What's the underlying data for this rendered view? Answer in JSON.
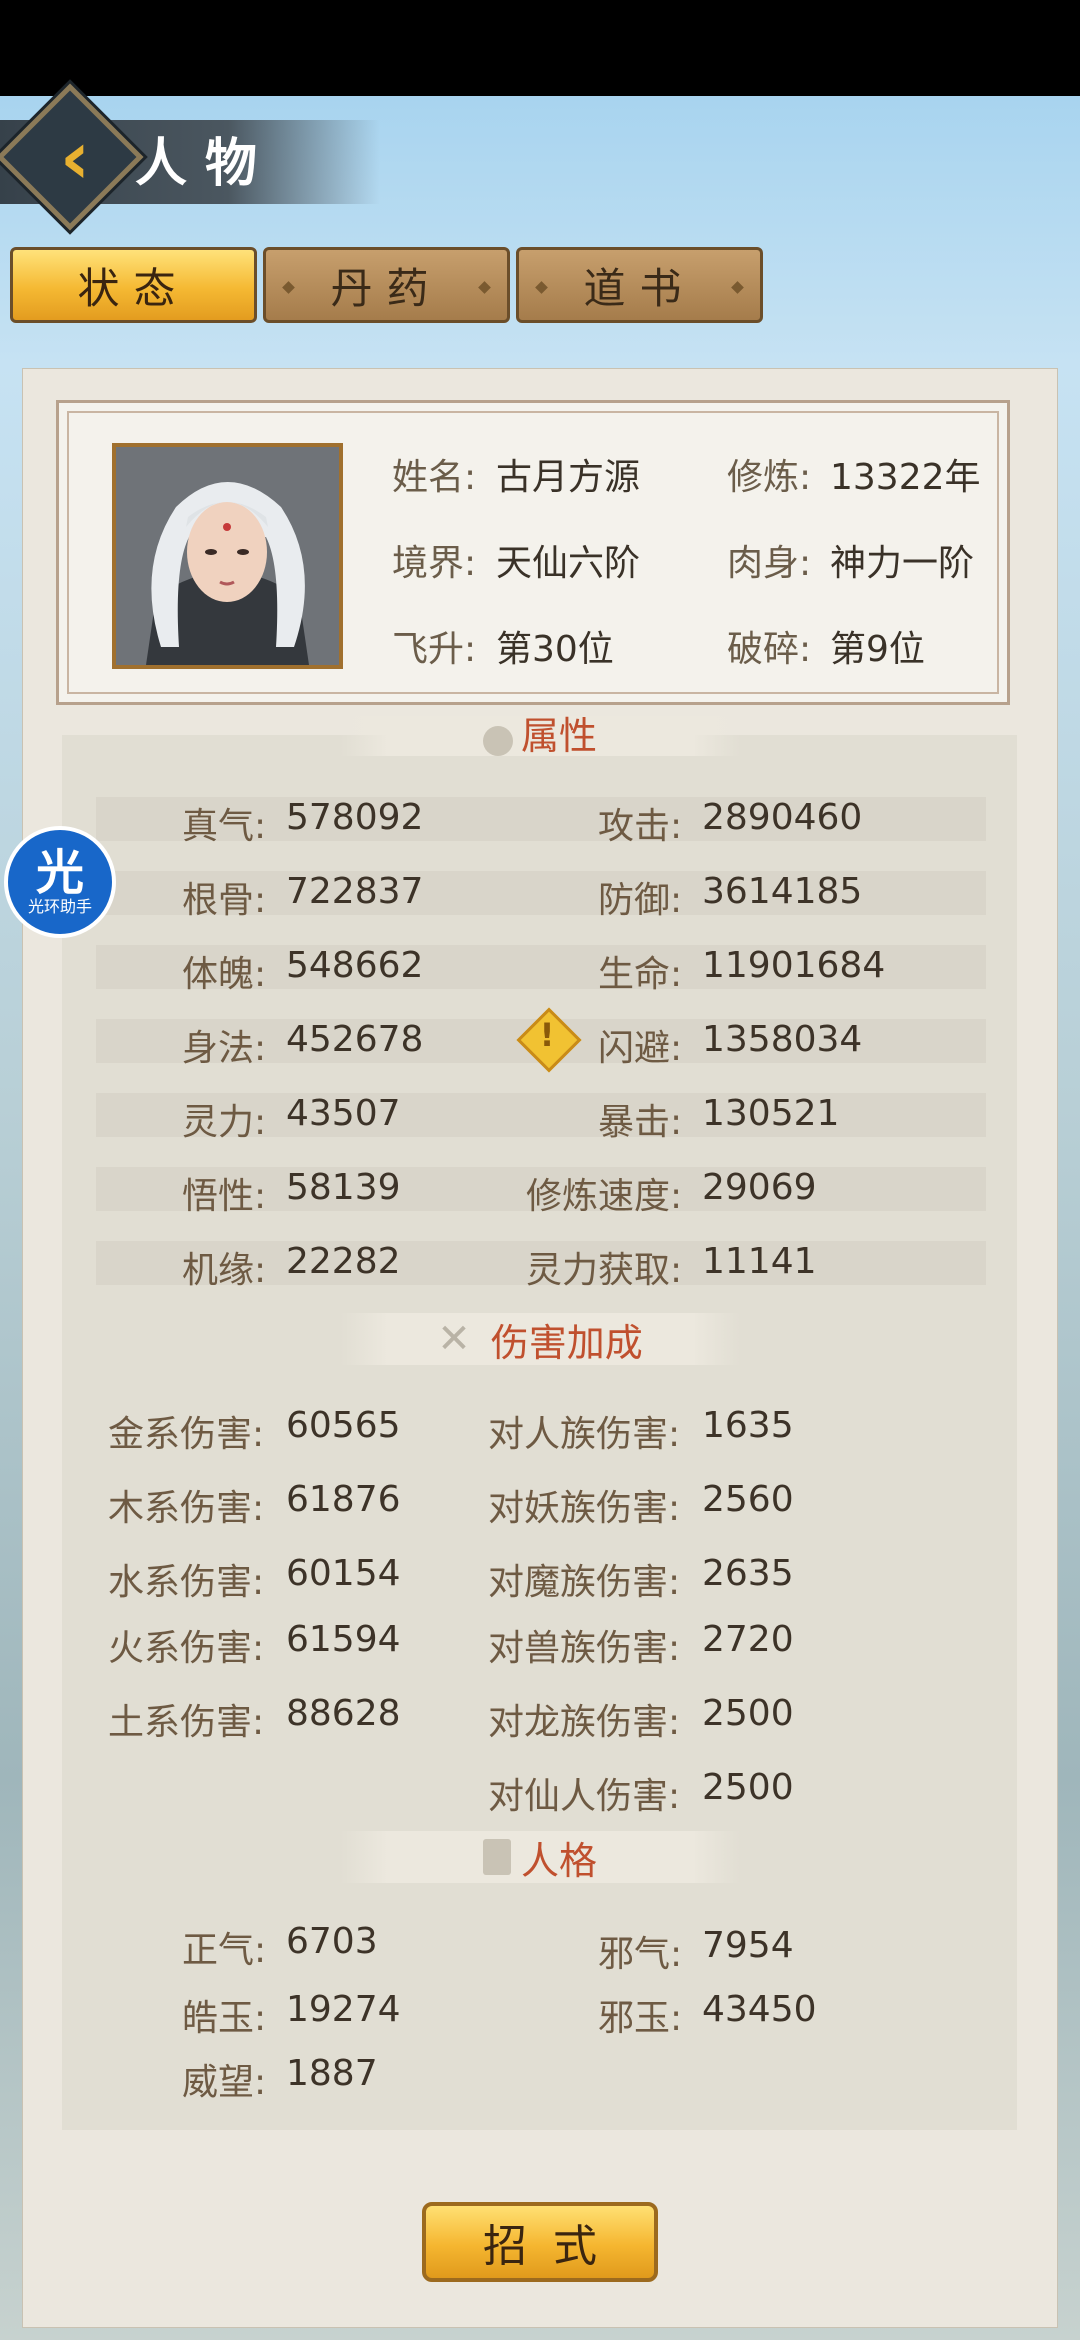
{
  "header": {
    "title": "人物"
  },
  "tabs": [
    {
      "label": "状态",
      "active": true
    },
    {
      "label": "丹药",
      "active": false
    },
    {
      "label": "道书",
      "active": false
    }
  ],
  "profile": {
    "name_label": "姓名:",
    "name": "古月方源",
    "cultivation_label": "修炼:",
    "cultivation": "13322年",
    "realm_label": "境界:",
    "realm": "天仙六阶",
    "body_label": "肉身:",
    "body": "神力一阶",
    "ascend_label": "飞升:",
    "ascend": "第30位",
    "shatter_label": "破碎:",
    "shatter": "第9位"
  },
  "sections": {
    "attributes": "属性",
    "damage": "伤害加成",
    "personality": "人格"
  },
  "attributes": [
    {
      "label": "真气:",
      "value": "578092"
    },
    {
      "label": "攻击:",
      "value": "2890460"
    },
    {
      "label": "根骨:",
      "value": "722837"
    },
    {
      "label": "防御:",
      "value": "3614185"
    },
    {
      "label": "体魄:",
      "value": "548662"
    },
    {
      "label": "生命:",
      "value": "11901684"
    },
    {
      "label": "身法:",
      "value": "452678"
    },
    {
      "label": "闪避:",
      "value": "1358034"
    },
    {
      "label": "灵力:",
      "value": "43507"
    },
    {
      "label": "暴击:",
      "value": "130521"
    },
    {
      "label": "悟性:",
      "value": "58139"
    },
    {
      "label": "修炼速度:",
      "value": "29069"
    },
    {
      "label": "机缘:",
      "value": "22282"
    },
    {
      "label": "灵力获取:",
      "value": "11141"
    }
  ],
  "damage_bonus": [
    {
      "label": "金系伤害:",
      "value": "60565"
    },
    {
      "label": "对人族伤害:",
      "value": "1635"
    },
    {
      "label": "木系伤害:",
      "value": "61876"
    },
    {
      "label": "对妖族伤害:",
      "value": "2560"
    },
    {
      "label": "水系伤害:",
      "value": "60154"
    },
    {
      "label": "对魔族伤害:",
      "value": "2635"
    },
    {
      "label": "火系伤害:",
      "value": "61594"
    },
    {
      "label": "对兽族伤害:",
      "value": "2720"
    },
    {
      "label": "土系伤害:",
      "value": "88628"
    },
    {
      "label": "对龙族伤害:",
      "value": "2500"
    },
    {
      "label": "对仙人伤害:",
      "value": "2500"
    }
  ],
  "personality": [
    {
      "label": "正气:",
      "value": "6703"
    },
    {
      "label": "邪气:",
      "value": "7954"
    },
    {
      "label": "皓玉:",
      "value": "19274"
    },
    {
      "label": "邪玉:",
      "value": "43450"
    },
    {
      "label": "威望:",
      "value": "1887"
    }
  ],
  "helper": {
    "big": "光",
    "small": "光环助手"
  },
  "bottom_button": "招式",
  "colors": {
    "accent_gold": "#f5b933",
    "section_red": "#c0502e",
    "panel": "#ebe7de"
  }
}
